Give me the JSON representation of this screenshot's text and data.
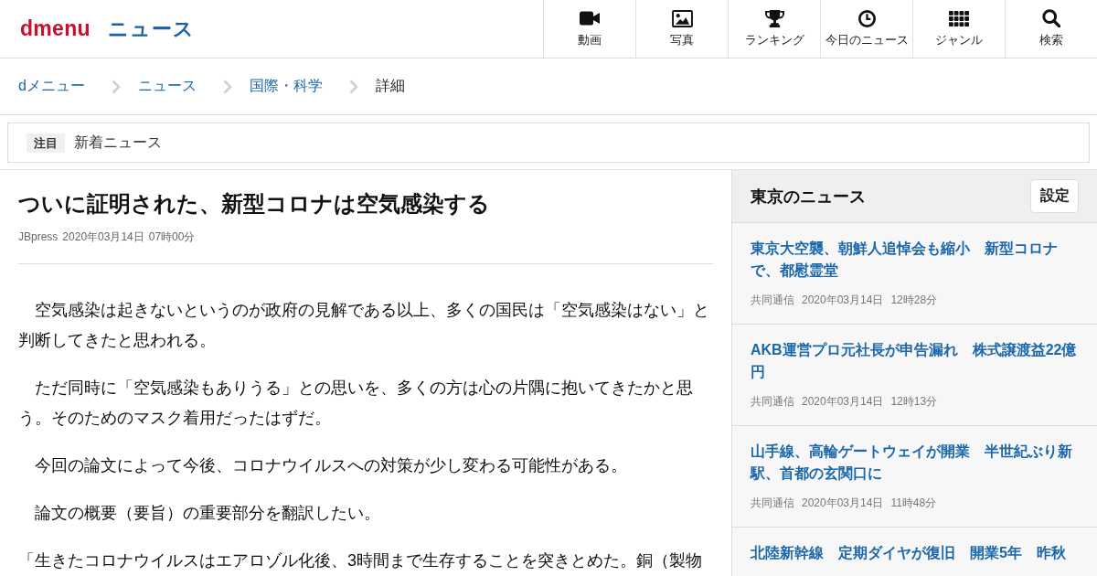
{
  "header": {
    "logo": "dmenu",
    "section_title": "ニュース",
    "nav": [
      {
        "label": "動画"
      },
      {
        "label": "写真"
      },
      {
        "label": "ランキング"
      },
      {
        "label": "今日のニュース"
      },
      {
        "label": "ジャンル"
      },
      {
        "label": "検索"
      }
    ]
  },
  "breadcrumb": [
    {
      "label": "dメニュー",
      "current": false
    },
    {
      "label": "ニュース",
      "current": false
    },
    {
      "label": "国際・科学",
      "current": false
    },
    {
      "label": "詳細",
      "current": true
    }
  ],
  "notice": {
    "badge": "注目",
    "text": "新着ニュース"
  },
  "article": {
    "title": "ついに証明された、新型コロナは空気感染する",
    "source": "JBpress",
    "date": "2020年03月14日",
    "time": "07時00分",
    "paragraphs": [
      "　空気感染は起きないというのが政府の見解である以上、多くの国民は「空気感染はない」と判断してきたと思われる。",
      "　ただ同時に「空気感染もありうる」との思いを、多くの方は心の片隅に抱いてきたかと思う。そのためのマスク着用だったはずだ。",
      "　今回の論文によって今後、コロナウイルスへの対策が少し変わる可能性がある。",
      "　論文の概要（要旨）の重要部分を翻訳したい。",
      "「生きたコロナウイルスはエアロゾル化後、3時間まで生存することを突きとめた。銅（製物"
    ]
  },
  "sidebar": {
    "title": "東京のニュース",
    "settings_button": "設定",
    "items": [
      {
        "headline": "東京大空襲、朝鮮人追悼会も縮小　新型コロナで、都慰霊堂",
        "source": "共同通信",
        "date": "2020年03月14日",
        "time": "12時28分"
      },
      {
        "headline": "AKB運営プロ元社長が申告漏れ　株式譲渡益22億円",
        "source": "共同通信",
        "date": "2020年03月14日",
        "time": "12時13分"
      },
      {
        "headline": "山手線、高輪ゲートウェイが開業　半世紀ぶり新駅、首都の玄関口に",
        "source": "共同通信",
        "date": "2020年03月14日",
        "time": "11時48分"
      },
      {
        "headline": "北陸新幹線　定期ダイヤが復旧　開業5年　昨秋"
      }
    ]
  }
}
